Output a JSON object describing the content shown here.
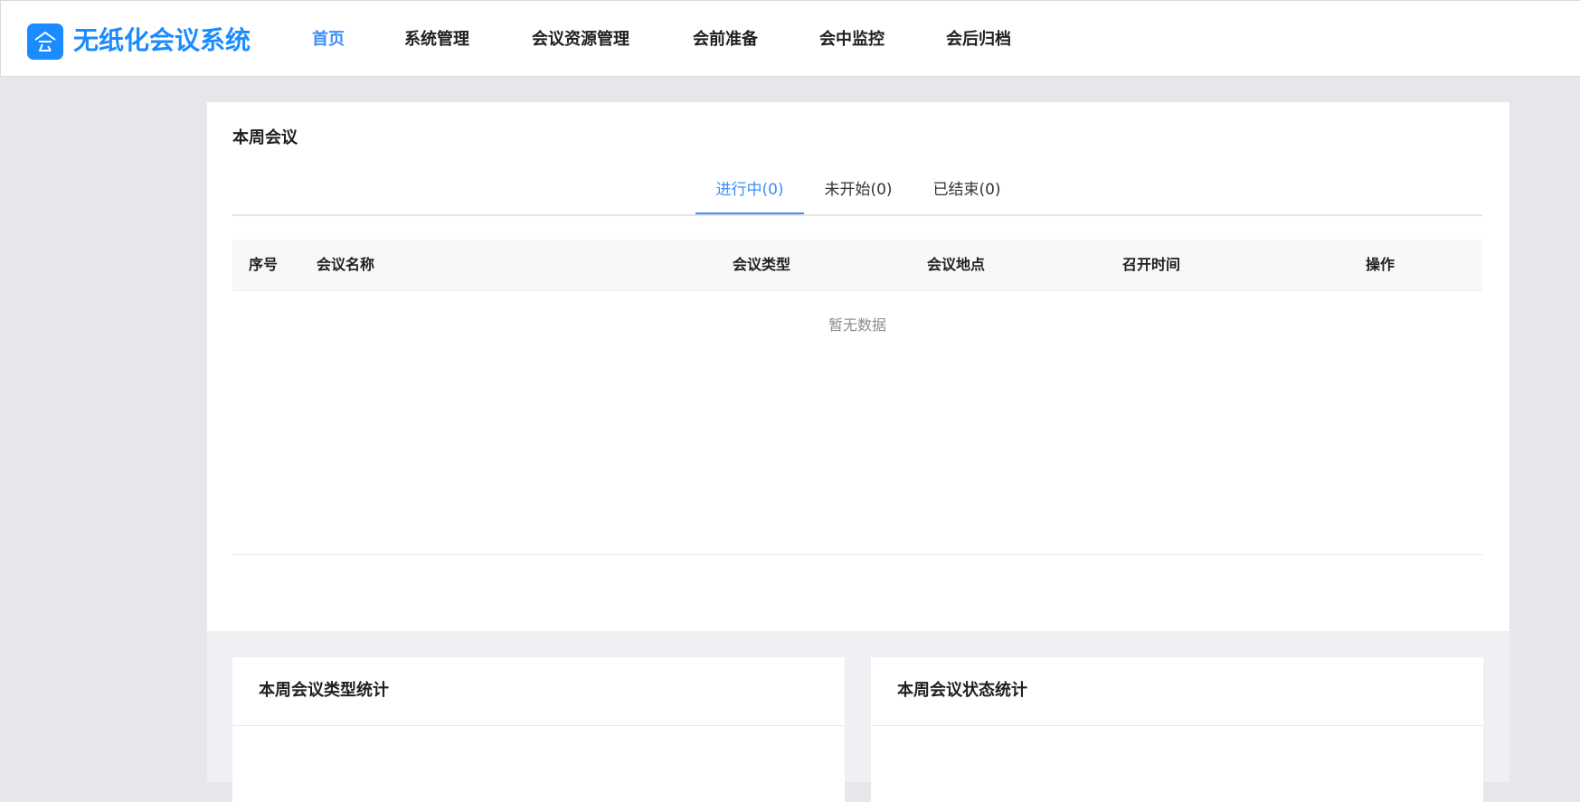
{
  "app": {
    "title": "无纸化会议系统",
    "logo_icon": "meeting-logo-icon",
    "brand_color": "#1a8cff"
  },
  "nav": {
    "items": [
      {
        "label": "首页",
        "active": true
      },
      {
        "label": "系统管理",
        "active": false
      },
      {
        "label": "会议资源管理",
        "active": false
      },
      {
        "label": "会前准备",
        "active": false
      },
      {
        "label": "会中监控",
        "active": false
      },
      {
        "label": "会后归档",
        "active": false
      }
    ],
    "active_color": "#3b8ff6"
  },
  "weekly_meetings": {
    "title": "本周会议",
    "tabs": [
      {
        "label": "进行中(0)",
        "active": true
      },
      {
        "label": "未开始(0)",
        "active": false
      },
      {
        "label": "已结束(0)",
        "active": false
      }
    ],
    "table": {
      "columns": [
        "序号",
        "会议名称",
        "会议类型",
        "会议地点",
        "召开时间",
        "操作"
      ],
      "rows": [],
      "empty_text": "暂无数据"
    }
  },
  "stats": {
    "type_title": "本周会议类型统计",
    "status_title": "本周会议状态统计"
  }
}
